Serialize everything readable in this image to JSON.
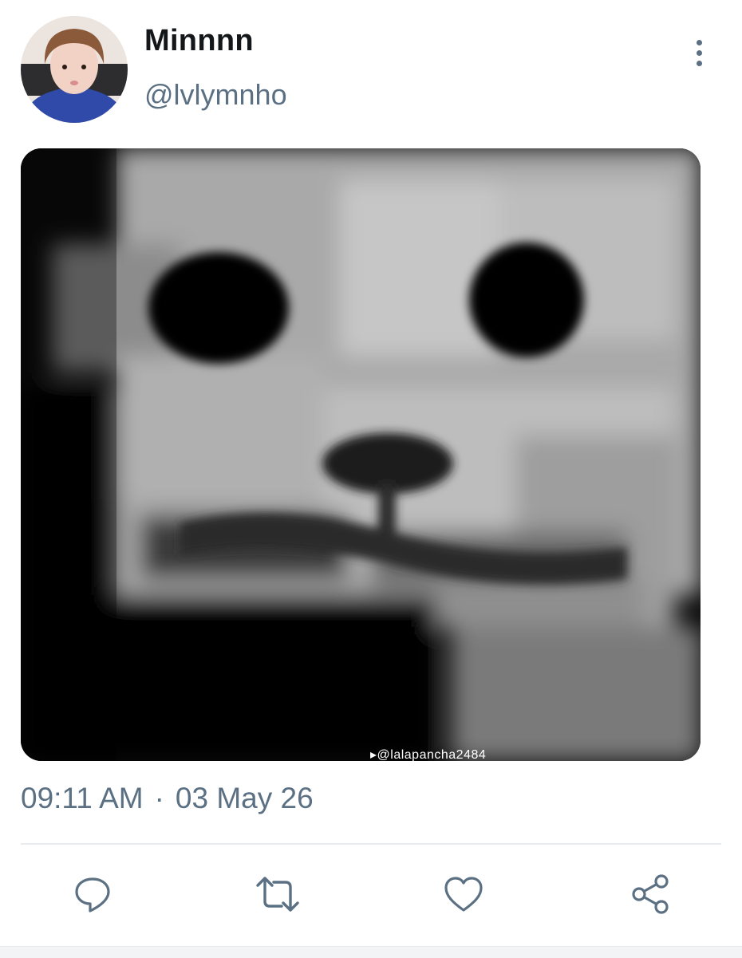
{
  "tweet": {
    "author": {
      "display_name": "Minnnn",
      "handle": "@lvlymnho",
      "avatar_icon": "profile-photo"
    },
    "media": {
      "description_icon": "cat-face-photo",
      "watermark": "▸@lalapancha2484"
    },
    "time": "09:11 AM",
    "separator": "·",
    "date": "03 May 26",
    "actions": [
      "reply-icon",
      "retweet-icon",
      "like-icon",
      "share-icon"
    ]
  },
  "colors": {
    "text_primary": "#14171a",
    "text_secondary": "#5b7083",
    "divider": "#e6ecf0"
  }
}
